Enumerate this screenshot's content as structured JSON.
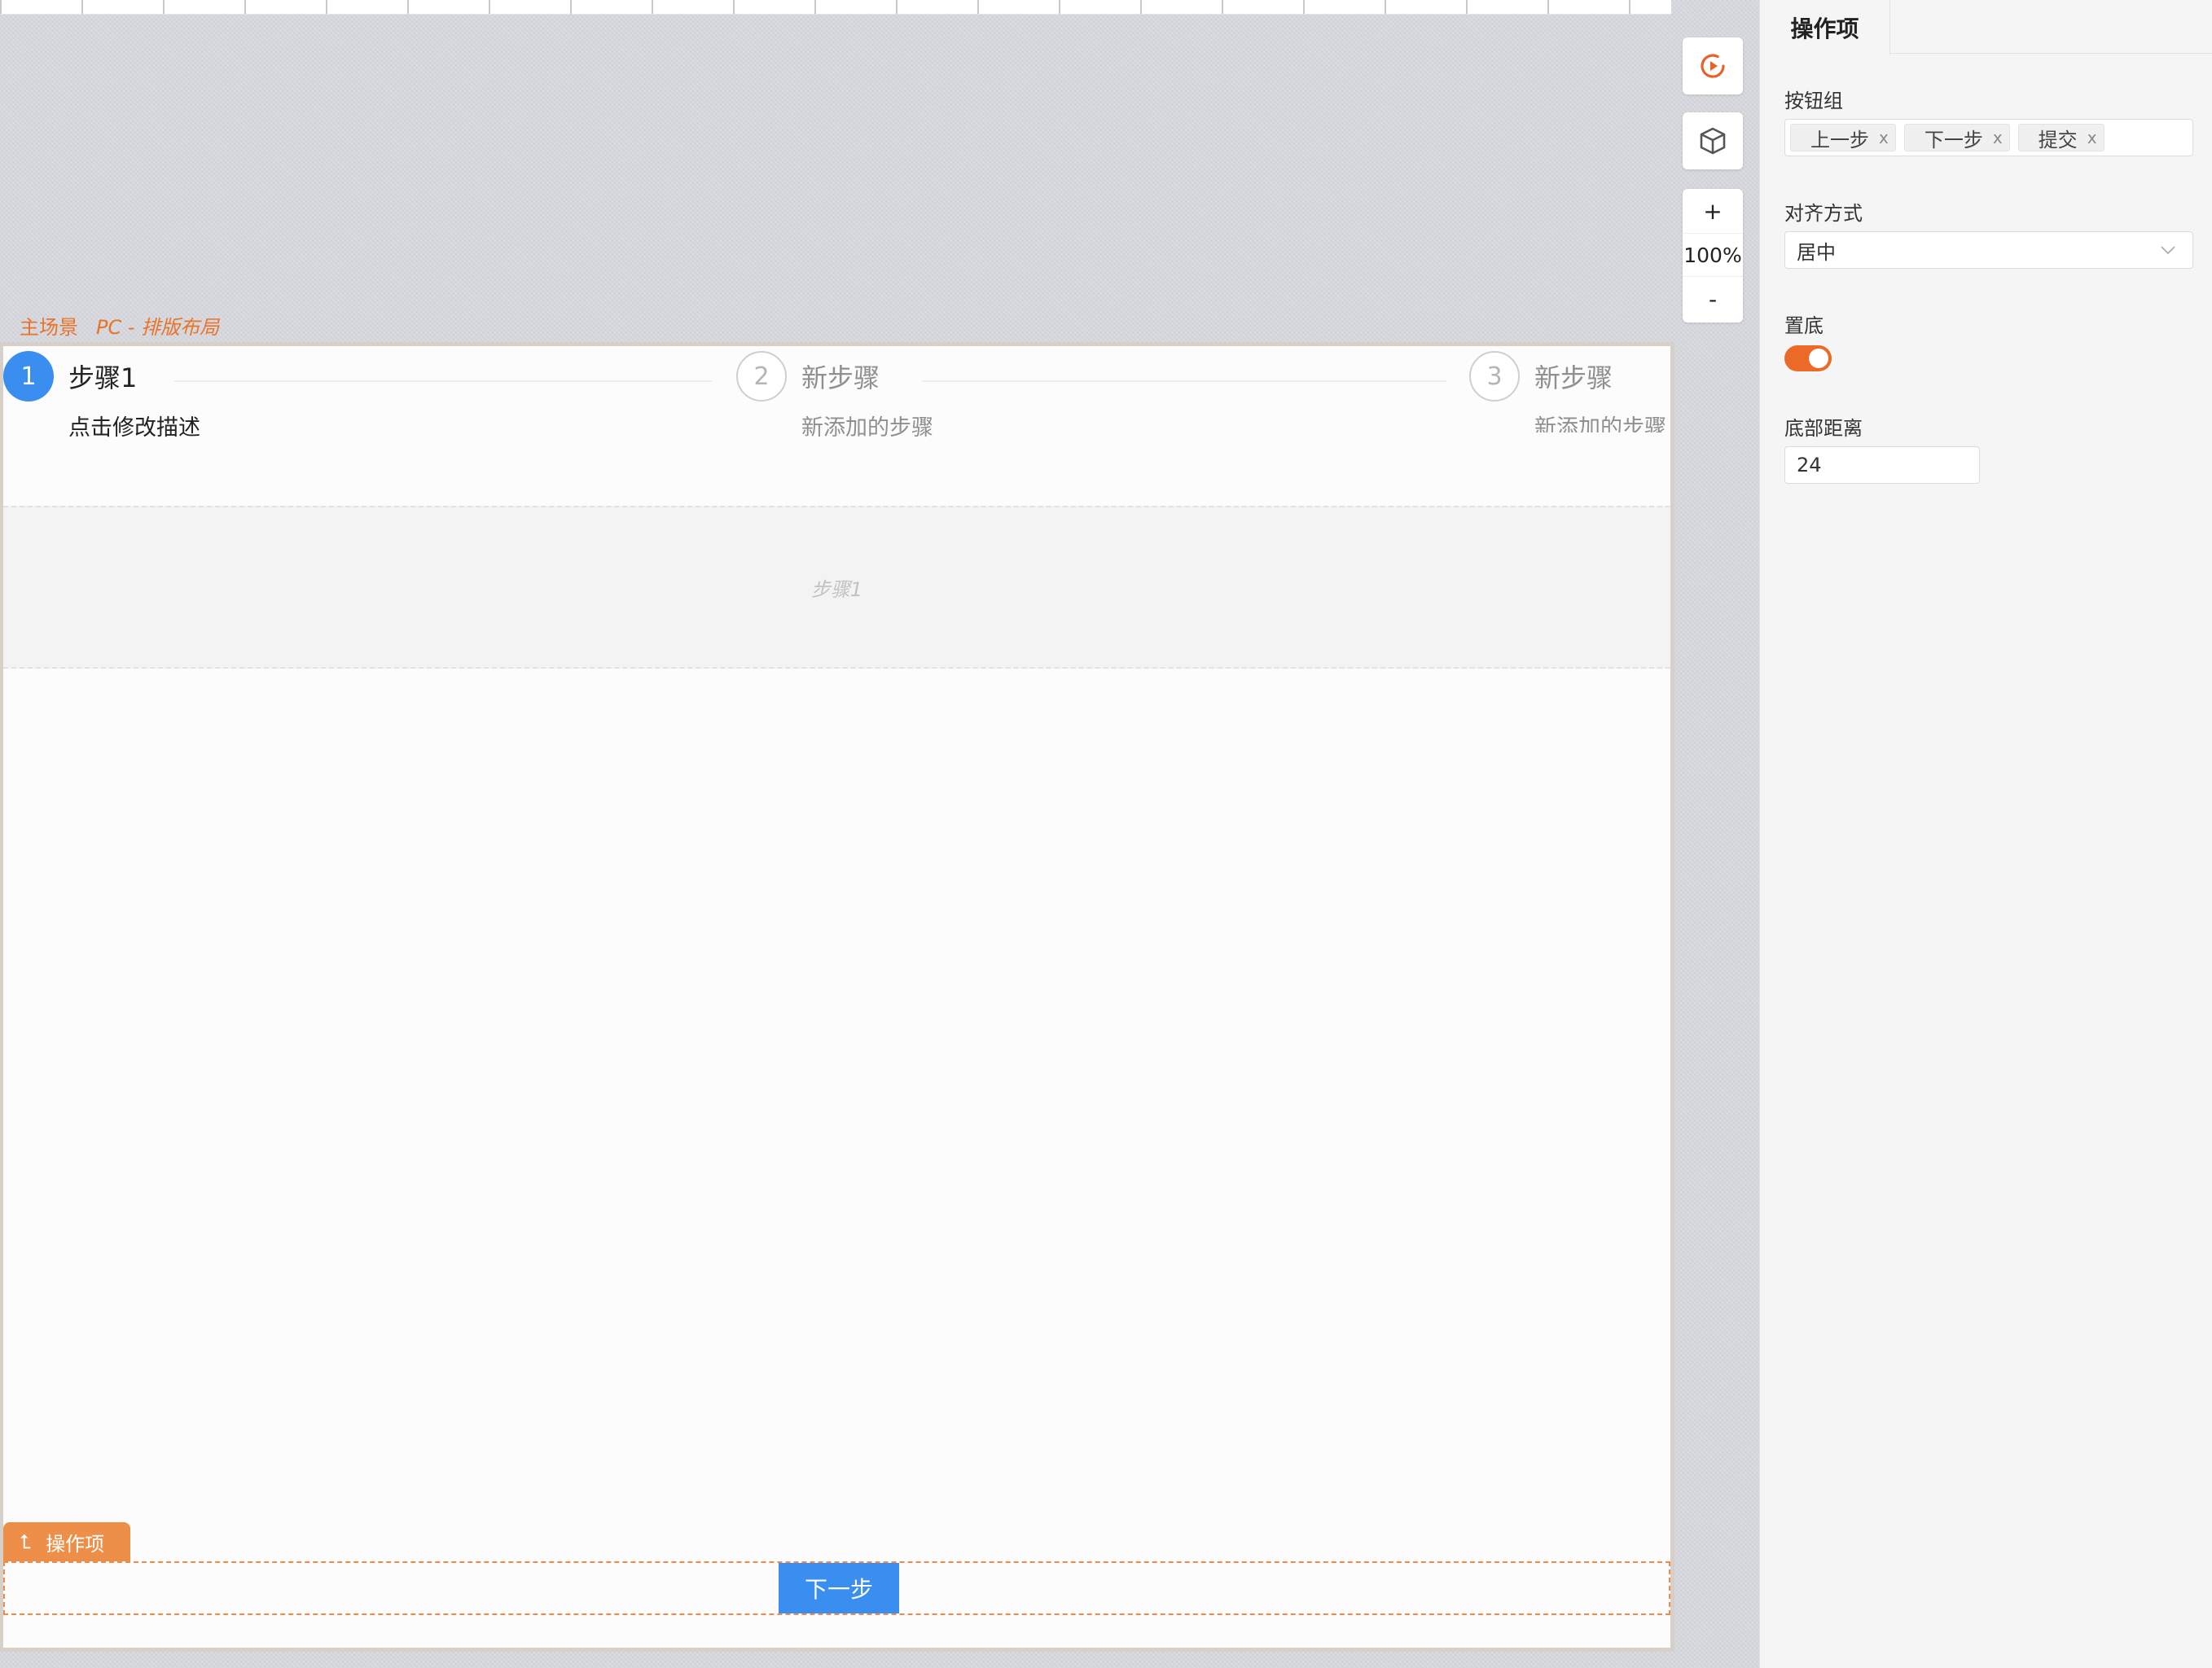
{
  "scene": {
    "main_label": "主场景",
    "layout_label": "PC - 排版布局"
  },
  "steps": [
    {
      "number": "1",
      "title": "步骤1",
      "description": "点击修改描述",
      "state": "active"
    },
    {
      "number": "2",
      "title": "新步骤",
      "description": "新添加的步骤",
      "state": "idle"
    },
    {
      "number": "3",
      "title": "新步骤",
      "description": "新添加的步骤",
      "state": "idle"
    }
  ],
  "step_content": {
    "placeholder": "步骤1"
  },
  "action_section": {
    "tag_label": "操作项",
    "next_button_label": "下一步"
  },
  "toolbar": {
    "play_icon": "play-circle-icon",
    "cube_icon": "cube-icon",
    "zoom_in": "+",
    "zoom_level": "100%",
    "zoom_out": "-"
  },
  "panel": {
    "tab": "操作项",
    "button_group_label": "按钮组",
    "button_group_tags": [
      "上一步",
      "下一步",
      "提交"
    ],
    "tag_remove": "x",
    "align_label": "对齐方式",
    "align_value": "居中",
    "pin_bottom_label": "置底",
    "pin_bottom_on": true,
    "bottom_distance_label": "底部距离",
    "bottom_distance_value": "24"
  },
  "colors": {
    "accent_blue": "#3a8ef0",
    "accent_orange": "#ec6a28",
    "tag_orange": "#ed8f48"
  }
}
